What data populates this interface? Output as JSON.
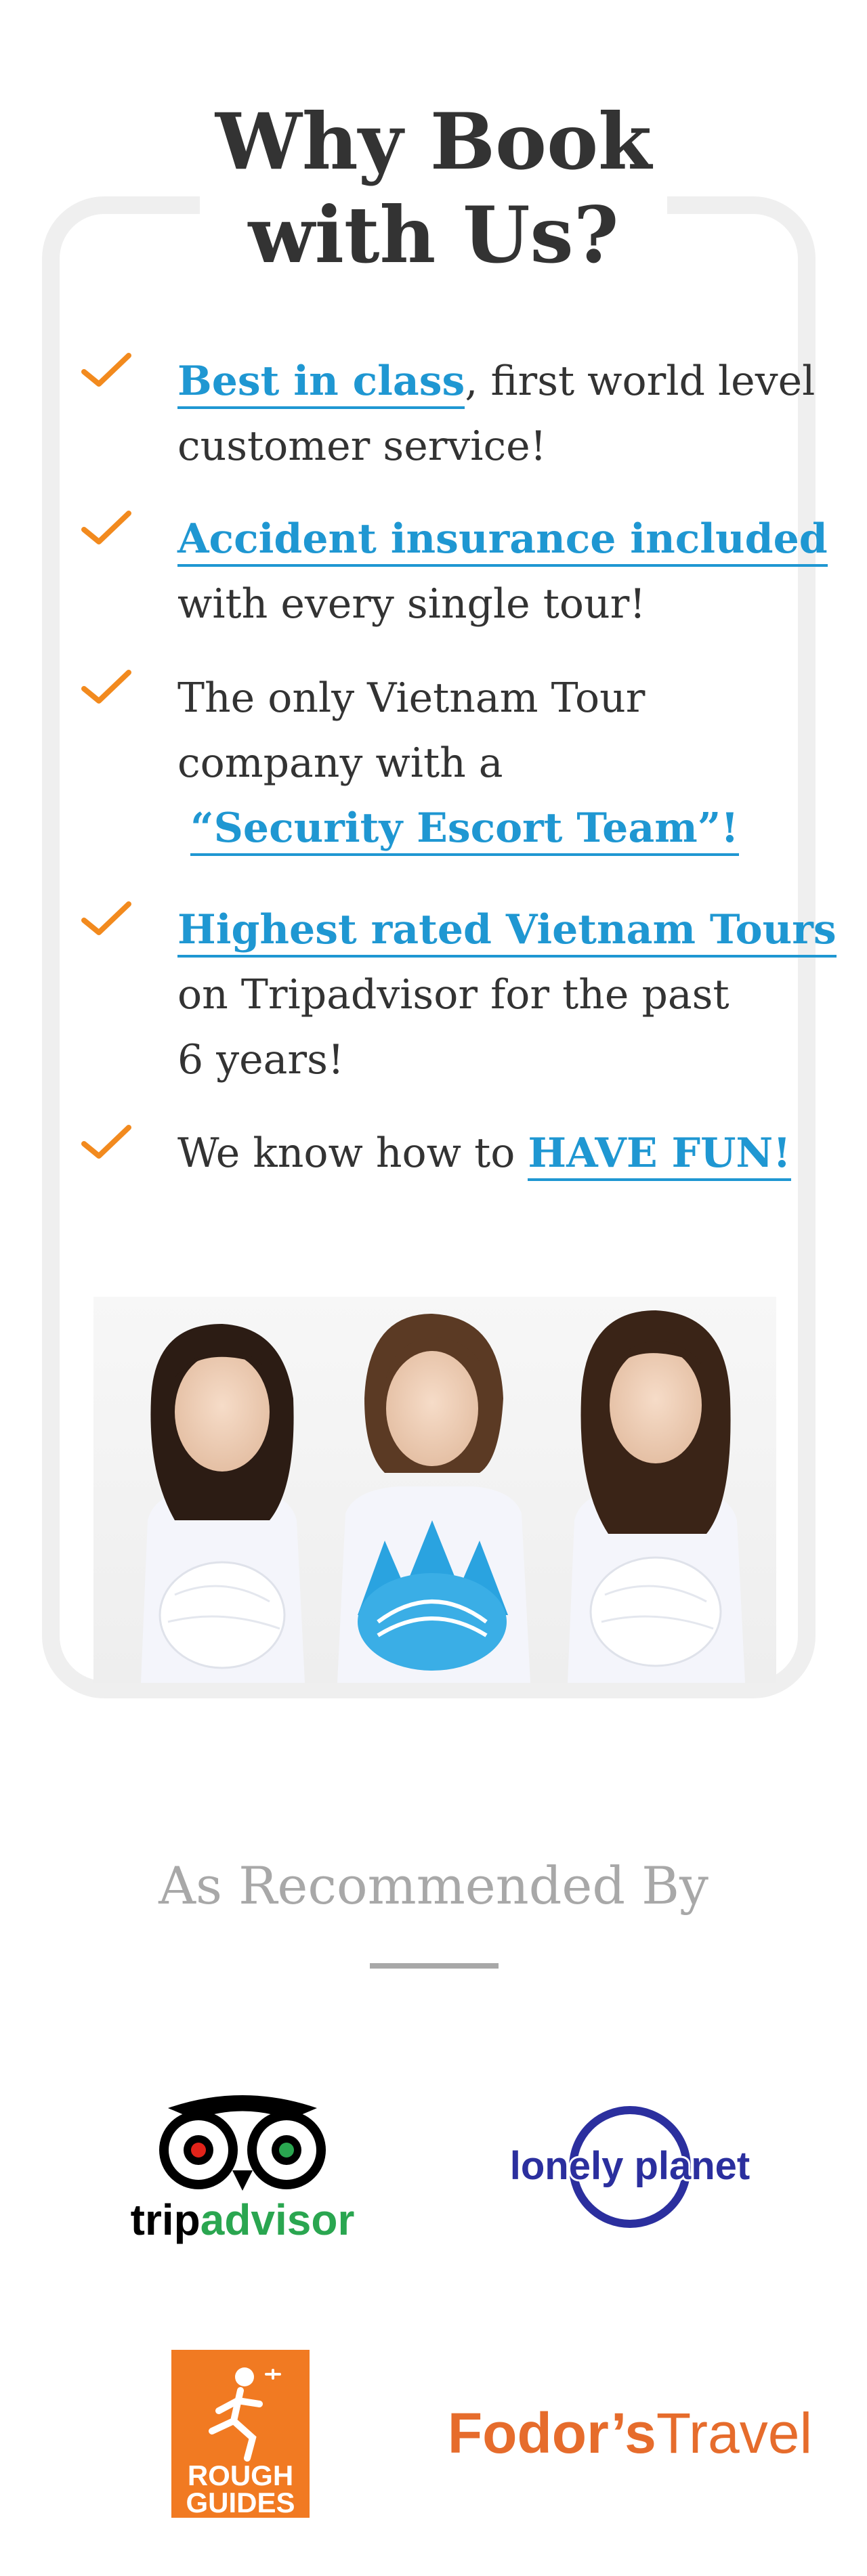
{
  "why_book": {
    "title_line1": "Why Book",
    "title_line2": "with Us?",
    "items": [
      {
        "highlight": "Best in class",
        "rest_line1": ", first world level",
        "rest_line2": "customer service!"
      },
      {
        "highlight": "Accident insurance included",
        "rest_line1": "with every single tour!"
      },
      {
        "line1": "The only Vietnam Tour",
        "line2": "company with a",
        "highlight": "“Security Escort Team”!"
      },
      {
        "highlight": "Highest rated Vietnam Tours",
        "line2": "on Tripadvisor for the past",
        "line3": "6 years!"
      },
      {
        "text": "We know how to ",
        "highlight": "HAVE FUN!"
      }
    ]
  },
  "recommended": {
    "title": "As Recommended By",
    "logos": {
      "tripadvisor_a": "trip",
      "tripadvisor_b": "advisor",
      "lonely_planet": "lonely planet",
      "rough_guides_1": "ROUGH",
      "rough_guides_2": "GUIDES",
      "fodors_a": "Fodor’s",
      "fodors_b": "Travel"
    }
  },
  "colors": {
    "accent_blue": "#1f97d2",
    "check_orange": "#f28a1e",
    "card_border": "#efefef",
    "muted_gray": "#a8a8a8",
    "tripadvisor_green": "#2aa650",
    "lonely_planet_blue": "#2b2f9e",
    "rough_guides_orange": "#f17a22",
    "fodors_orange": "#e66c2c"
  },
  "icons": {
    "check": "checkmark-icon"
  }
}
